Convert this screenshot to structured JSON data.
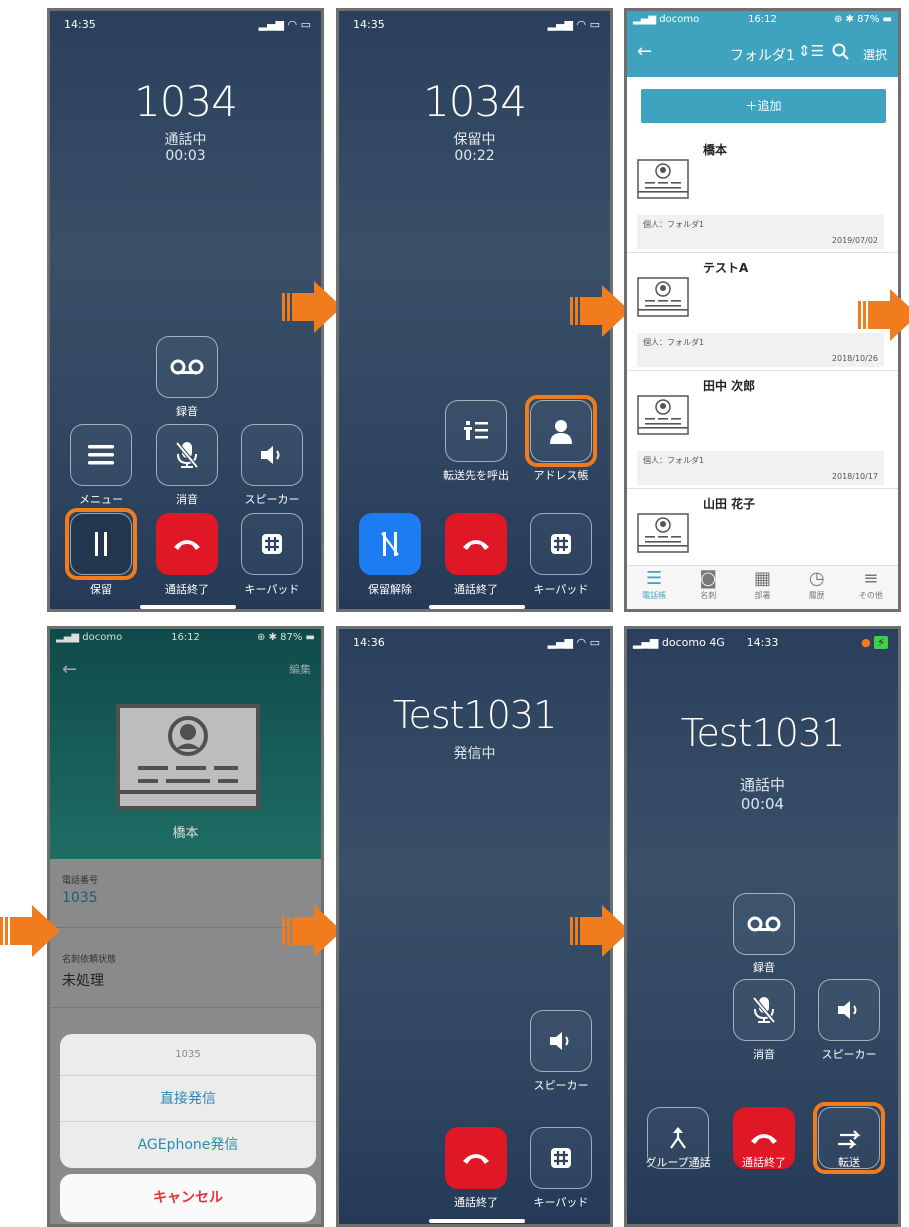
{
  "panel1": {
    "time": "14:35",
    "number": "1034",
    "status": "通話中",
    "duration": "00:03",
    "record_label": "録音",
    "menu_label": "メニュー",
    "mute_label": "消音",
    "speaker_label": "スピーカー",
    "hold_label": "保留",
    "end_label": "通話終了",
    "keypad_label": "キーパッド",
    "icons": [
      "voicemail-icon",
      "menu-icon",
      "mic-off-icon",
      "speaker-icon",
      "pause-icon",
      "hangup-icon",
      "keypad-icon"
    ]
  },
  "panel2": {
    "time": "14:35",
    "number": "1034",
    "status": "保留中",
    "duration": "00:22",
    "transfer_call_label": "転送先を呼出",
    "address_label": "アドレス帳",
    "unhold_label": "保留解除",
    "end_label": "通話終了",
    "keypad_label": "キーパッド"
  },
  "panel3": {
    "carrier": "docomo",
    "time": "16:12",
    "battery": "87%",
    "title": "フォルダ1",
    "select_label": "選択",
    "add_label": "＋追加",
    "contacts": [
      {
        "name": "橋本",
        "folder": "個人：フォルダ1",
        "date": "2019/07/02"
      },
      {
        "name": "テストA",
        "folder": "個人：フォルダ1",
        "date": "2018/10/26"
      },
      {
        "name": "田中 次郎",
        "folder": "個人：フォルダ1",
        "date": "2018/10/17"
      },
      {
        "name": "山田 花子"
      }
    ],
    "tabs": [
      "電話帳",
      "名刺",
      "部署",
      "履歴",
      "その他"
    ],
    "accent": "#3fa3bf"
  },
  "panel4": {
    "carrier": "docomo",
    "time": "16:12",
    "battery": "87%",
    "edit_label": "編集",
    "name": "橋本",
    "phone_field_label": "電話番号",
    "phone_value": "1035",
    "status_field_label": "名刺依頼状態",
    "status_value": "未処理",
    "sheet_title": "1035",
    "direct_call": "直接発信",
    "age_call": "AGEphone発信",
    "cancel": "キャンセル"
  },
  "panel5": {
    "time": "14:36",
    "name": "Test1031",
    "status": "発信中",
    "speaker_label": "スピーカー",
    "end_label": "通話終了",
    "keypad_label": "キーパッド"
  },
  "panel6": {
    "carrier": "docomo",
    "network": "4G",
    "time": "14:33",
    "name": "Test1031",
    "status": "通話中",
    "duration": "00:04",
    "record_label": "録音",
    "mute_label": "消音",
    "speaker_label": "スピーカー",
    "group_label": "グループ通話",
    "end_label": "通話終了",
    "transfer_label": "転送"
  },
  "colors": {
    "highlight": "#f07c1e",
    "end_call": "#e01725",
    "unhold": "#1e7cf2",
    "cancel": "#e8323a"
  }
}
